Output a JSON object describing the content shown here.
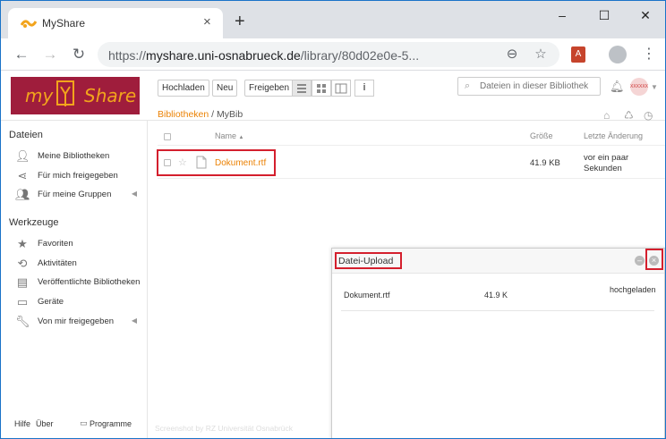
{
  "browser": {
    "tab_title": "MyShare",
    "tab_close": "×",
    "new_tab": "+",
    "url_scheme": "https://",
    "url_host": "myshare.uni-osnabrueck.de",
    "url_path": "/library/80d02e0e-5...",
    "minimize": "–",
    "maximize": "☐",
    "close": "✕",
    "pdf_ext": "A"
  },
  "app": {
    "logo_my": "my",
    "logo_share": "Share",
    "toolbar": {
      "upload": "Hochladen",
      "new": "Neu",
      "share": "Freigeben",
      "info": "i"
    },
    "search": {
      "placeholder": "Dateien in dieser Bibliothek"
    },
    "avatar_text": "XXXXXX"
  },
  "sidebar": {
    "files_heading": "Dateien",
    "files_items": [
      {
        "label": "Meine Bibliotheken",
        "icon": "user-icon"
      },
      {
        "label": "Für mich freigegeben",
        "icon": "share-icon"
      },
      {
        "label": "Für meine Gruppen",
        "icon": "group-icon"
      }
    ],
    "tools_heading": "Werkzeuge",
    "tools_items": [
      {
        "label": "Favoriten",
        "icon": "star-icon"
      },
      {
        "label": "Aktivitäten",
        "icon": "history-icon"
      },
      {
        "label": "Veröffentlichte Bibliotheken",
        "icon": "published-icon"
      },
      {
        "label": "Geräte",
        "icon": "monitor-icon"
      },
      {
        "label": "Von mir freigegeben",
        "icon": "wrench-icon"
      }
    ],
    "footer": {
      "help": "Hilfe",
      "about": "Über",
      "programs": "Programme"
    }
  },
  "main": {
    "breadcrumb": {
      "library": "Bibliotheken",
      "separator": "/",
      "current": "MyBib"
    },
    "columns": {
      "name": "Name",
      "size": "Größe",
      "modified": "Letzte Änderung"
    },
    "files": [
      {
        "name": "Dokument.rtf",
        "size": "41.9 KB",
        "modified": "vor ein paar Sekunden"
      }
    ]
  },
  "upload": {
    "title": "Datei-Upload",
    "minimize": "–",
    "close": "×",
    "items": [
      {
        "name": "Dokument.rtf",
        "size": "41.9 K",
        "status": "hochgeladen"
      }
    ]
  },
  "watermark": "Screenshot by RZ Universität Osnabrück",
  "colors": {
    "accent": "#eb8205",
    "logo_bg": "#9f1d3c",
    "highlight": "#d41f2d"
  }
}
